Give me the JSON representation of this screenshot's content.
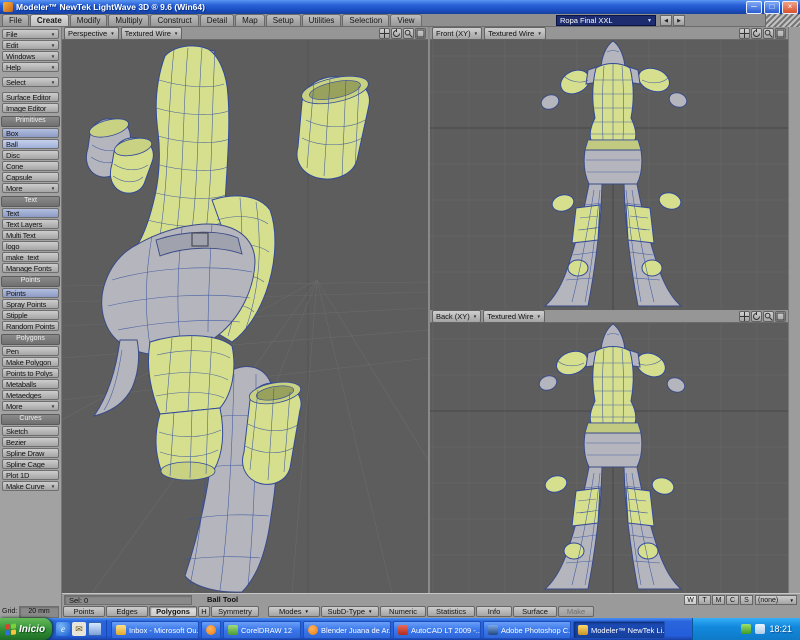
{
  "window": {
    "title": "Modeler™  NewTek LightWave 3D ® 9.6  (Win64)",
    "content_selector": "Ropa Final XXL"
  },
  "icons": {
    "dropdown": "▼",
    "minimize": "─",
    "maximize": "□",
    "close": "×",
    "prev": "◀",
    "next": "▶",
    "ie": "e",
    "envelope": "✉"
  },
  "tabs": {
    "items": [
      "File",
      "Create",
      "Modify",
      "Multiply",
      "Construct",
      "Detail",
      "Map",
      "Setup",
      "Utilities",
      "Selection",
      "View"
    ],
    "active": "Create"
  },
  "sidebar": {
    "menus": [
      "File",
      "Edit",
      "Windows",
      "Help"
    ],
    "select": "Select",
    "surface_editor": "Surface Editor",
    "image_editor": "Image Editor",
    "sections": [
      {
        "title": "Primitives",
        "items": [
          "Box",
          "Ball",
          "Disc",
          "Cone",
          "Capsule",
          "More"
        ]
      },
      {
        "title": "Text",
        "items": [
          "Text",
          "Text Layers",
          "Multi Text",
          "logo",
          "make_text",
          "Manage Fonts"
        ]
      },
      {
        "title": "Points",
        "items": [
          "Points",
          "Spray Points",
          "Stipple",
          "Random Points"
        ]
      },
      {
        "title": "Polygons",
        "items": [
          "Pen",
          "Make Polygon",
          "Points to Polys",
          "Metaballs",
          "Metaedges",
          "More"
        ]
      },
      {
        "title": "Curves",
        "items": [
          "Sketch",
          "Bezier",
          "Spline Draw",
          "Spline Cage",
          "Plot 1D",
          "Make Curve"
        ]
      }
    ]
  },
  "viewports": {
    "perspective": {
      "view": "Perspective",
      "shading": "Textured Wire"
    },
    "front": {
      "view": "Front  (XY)",
      "shading": "Textured Wire"
    },
    "back": {
      "view": "Back  (XY)",
      "shading": "Textured Wire"
    }
  },
  "status": {
    "sel": "Sel: 0",
    "tool": "Ball Tool",
    "grid_label": "Grid:",
    "grid_value": "20 mm",
    "modes": [
      "Points",
      "Edges",
      "Polygons"
    ],
    "polygons_shortcut": "H",
    "symmetry": "Symmetry",
    "dropdowns": [
      "Modes",
      "SubD-Type"
    ],
    "buttons": [
      "Numeric",
      "Statistics",
      "Info",
      "Surface"
    ],
    "make": "Make",
    "vmap_types": [
      "W",
      "T",
      "M",
      "C",
      "S"
    ],
    "vmap": "(none)"
  },
  "taskbar": {
    "start": "Inicio",
    "tasks": [
      {
        "label": "Inbox - Microsoft Ou..."
      },
      {
        "label": ""
      },
      {
        "label": "CorelDRAW 12"
      },
      {
        "label": "Blender Juana de Ar..."
      },
      {
        "label": "AutoCAD LT 2009 -..."
      },
      {
        "label": "Adobe Photoshop C..."
      },
      {
        "label": "Modeler™ NewTek Li..."
      }
    ],
    "time": "18:21"
  },
  "colors": {
    "model_yellow": "#d6df8e",
    "wireframe_blue": "#3c56a0",
    "viewport_gray": "#5d5d5d",
    "taskbar_blue": "#245edb",
    "start_green": "#2d8b33"
  }
}
